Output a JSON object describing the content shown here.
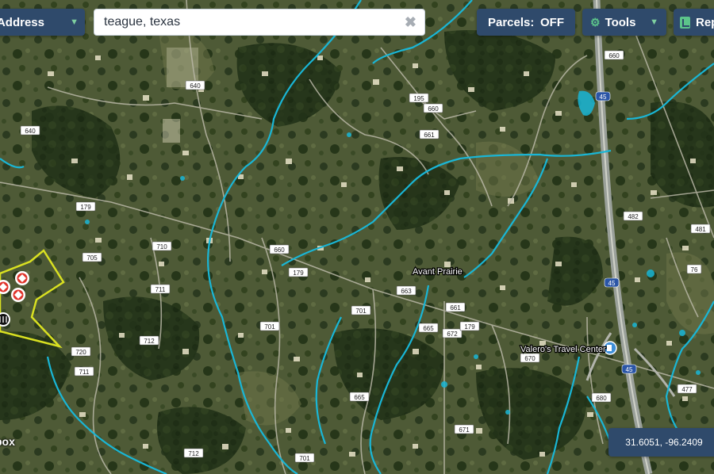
{
  "toolbar": {
    "search_mode_label": "y Address",
    "search_value": "teague, texas",
    "parcels_label": "Parcels:",
    "parcels_state": "OFF",
    "tools_label": "Tools",
    "reports_label": "Rep"
  },
  "map": {
    "coordinates": "31.6051, -96.2409",
    "places": [
      "Avant Prairie",
      "Valero's Travel Center"
    ],
    "partial_label": "box",
    "road_labels": [
      "640",
      "640",
      "195",
      "660",
      "661",
      "660",
      "179",
      "179",
      "705",
      "710",
      "711",
      "701",
      "712",
      "720",
      "711",
      "701",
      "663",
      "661",
      "665",
      "672",
      "179",
      "670",
      "665",
      "680",
      "671",
      "701",
      "712",
      "482",
      "481",
      "76",
      "477",
      "45",
      "45",
      "45",
      "660"
    ],
    "colors": {
      "water": "#19b6d6",
      "selection_outline": "#d9e021",
      "markers": "#e0342b",
      "ui_panel": "#2f4a6b",
      "ui_accent": "#5cc48a"
    }
  }
}
